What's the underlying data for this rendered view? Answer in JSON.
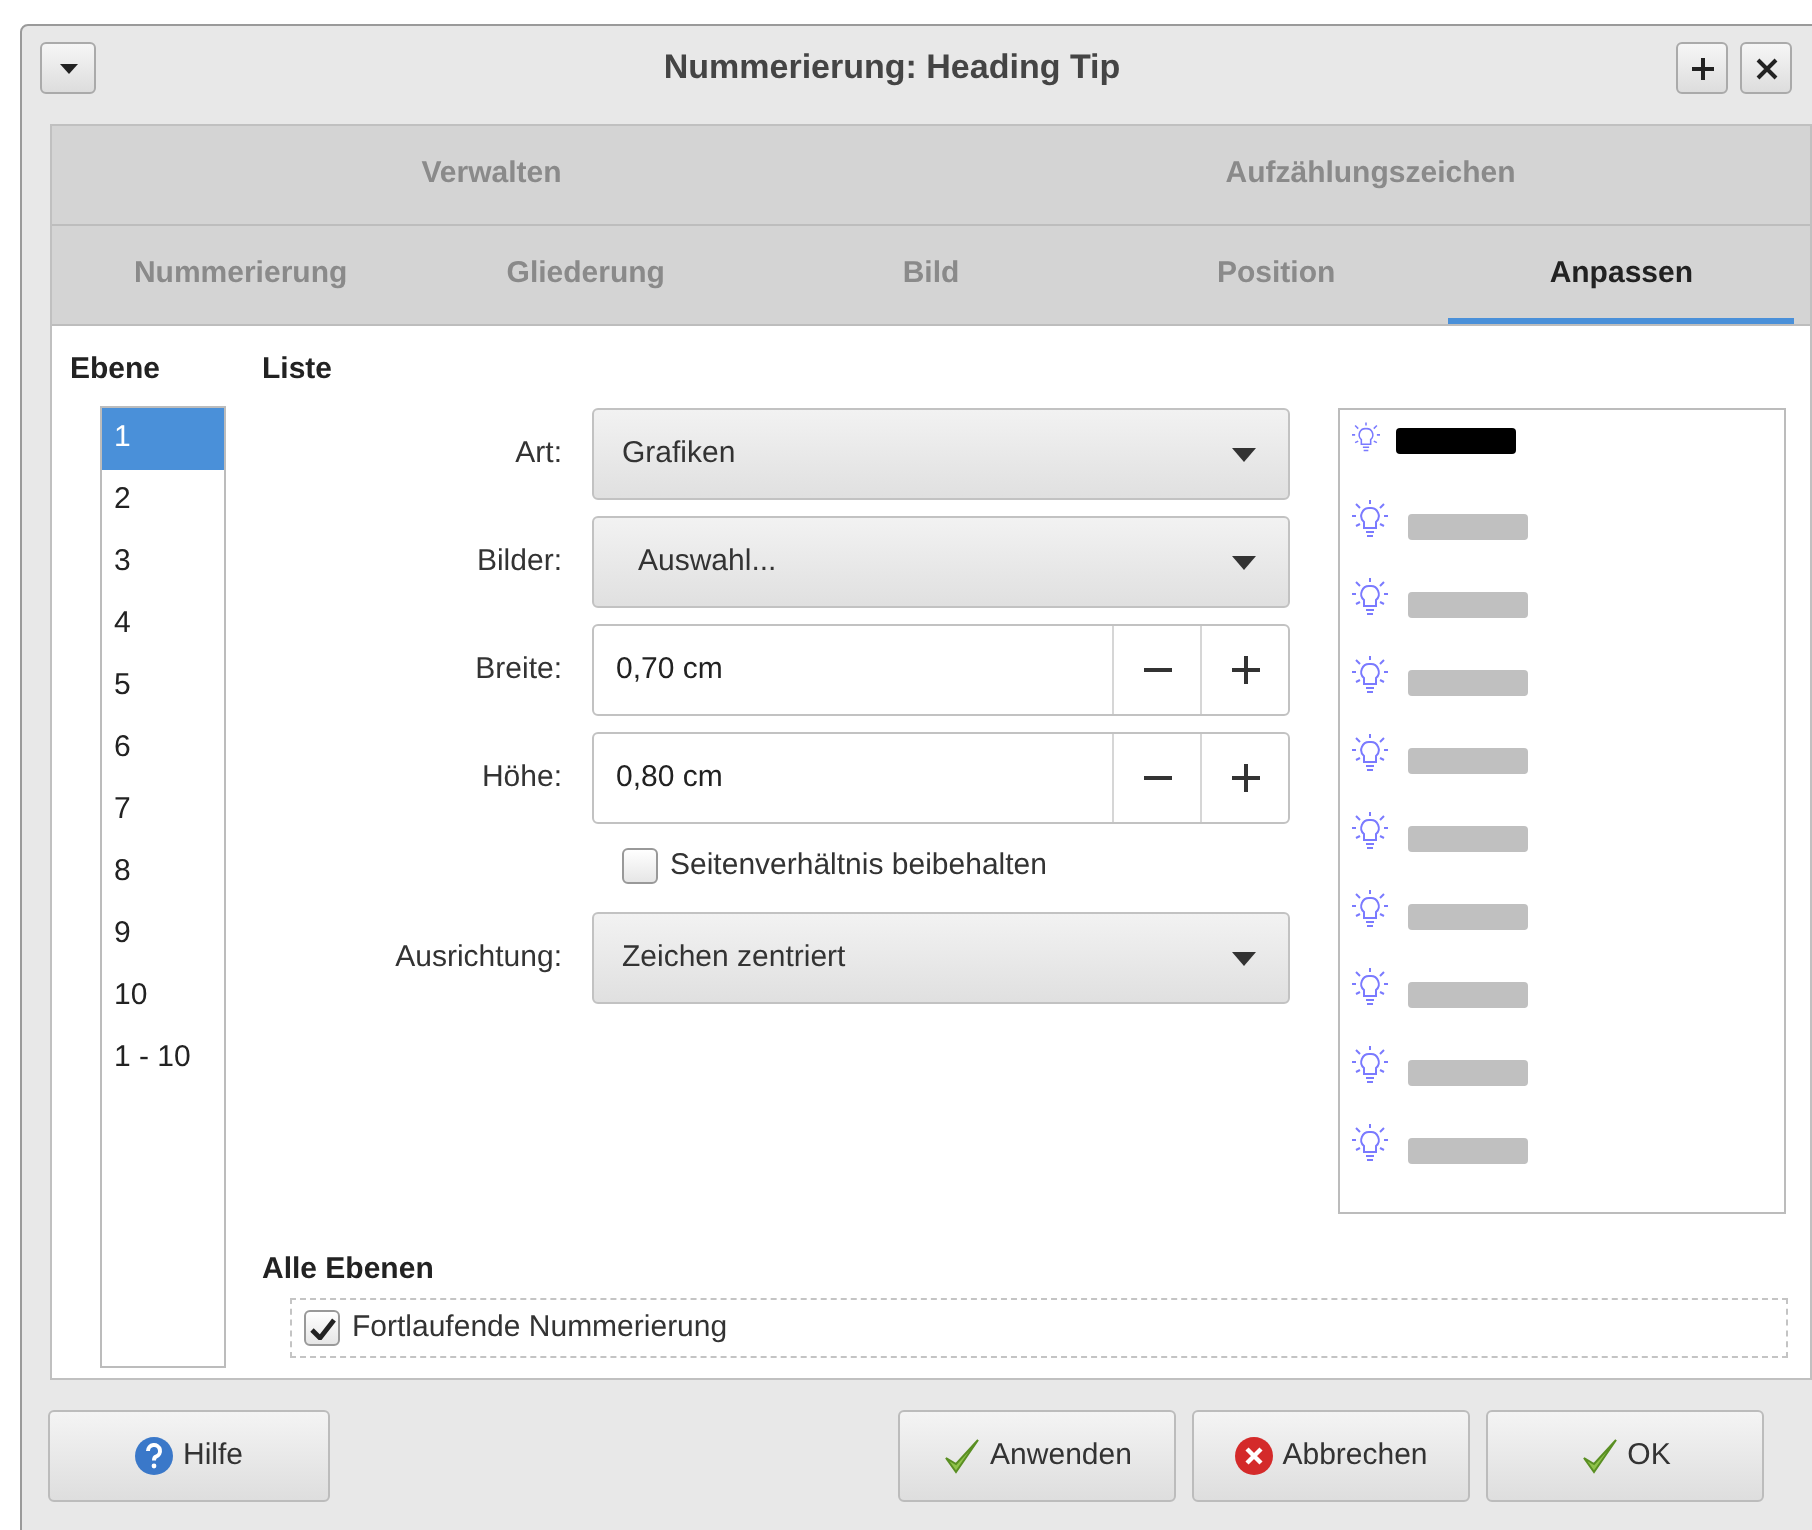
{
  "window": {
    "title": "Nummerierung: Heading Tip"
  },
  "tabs_top": [
    {
      "label": "Verwalten",
      "selected": false
    },
    {
      "label": "Aufzählungszeichen",
      "selected": false
    }
  ],
  "tabs": [
    {
      "label": "Nummerierung",
      "selected": false
    },
    {
      "label": "Gliederung",
      "selected": false
    },
    {
      "label": "Bild",
      "selected": false
    },
    {
      "label": "Position",
      "selected": false
    },
    {
      "label": "Anpassen",
      "selected": true
    }
  ],
  "levels": {
    "heading": "Ebene",
    "items": [
      {
        "label": "1",
        "selected": true
      },
      {
        "label": "2",
        "selected": false
      },
      {
        "label": "3",
        "selected": false
      },
      {
        "label": "4",
        "selected": false
      },
      {
        "label": "5",
        "selected": false
      },
      {
        "label": "6",
        "selected": false
      },
      {
        "label": "7",
        "selected": false
      },
      {
        "label": "8",
        "selected": false
      },
      {
        "label": "9",
        "selected": false
      },
      {
        "label": "10",
        "selected": false
      },
      {
        "label": "1 - 10",
        "selected": false
      }
    ]
  },
  "list": {
    "heading": "Liste",
    "fields": [
      {
        "kind": "dropdown",
        "label": "Art:",
        "value": "Grafiken",
        "indent": false
      },
      {
        "kind": "dropdown",
        "label": "Bilder:",
        "value": "Auswahl...",
        "indent": true
      },
      {
        "kind": "spin",
        "label": "Breite:",
        "value": "0,70 cm"
      },
      {
        "kind": "spin",
        "label": "Höhe:",
        "value": "0,80 cm"
      },
      {
        "kind": "checkbox",
        "label": "Seitenverhältnis beibehalten",
        "checked": false
      },
      {
        "kind": "dropdown",
        "label": "Ausrichtung:",
        "value": "Zeichen zentriert",
        "indent": false
      }
    ]
  },
  "preview": [
    {
      "selected": true
    },
    {
      "selected": false
    },
    {
      "selected": false
    },
    {
      "selected": false
    },
    {
      "selected": false
    },
    {
      "selected": false
    },
    {
      "selected": false
    },
    {
      "selected": false
    },
    {
      "selected": false
    },
    {
      "selected": false
    }
  ],
  "all_levels": {
    "heading": "Alle Ebenen",
    "continuous": {
      "label": "Fortlaufende Nummerierung",
      "checked": true
    }
  },
  "buttons": [
    {
      "kind": "help",
      "label": "Hilfe"
    },
    {
      "kind": "apply",
      "label": "Anwenden"
    },
    {
      "kind": "cancel",
      "label": "Abbrechen"
    },
    {
      "kind": "ok",
      "label": "OK"
    }
  ]
}
